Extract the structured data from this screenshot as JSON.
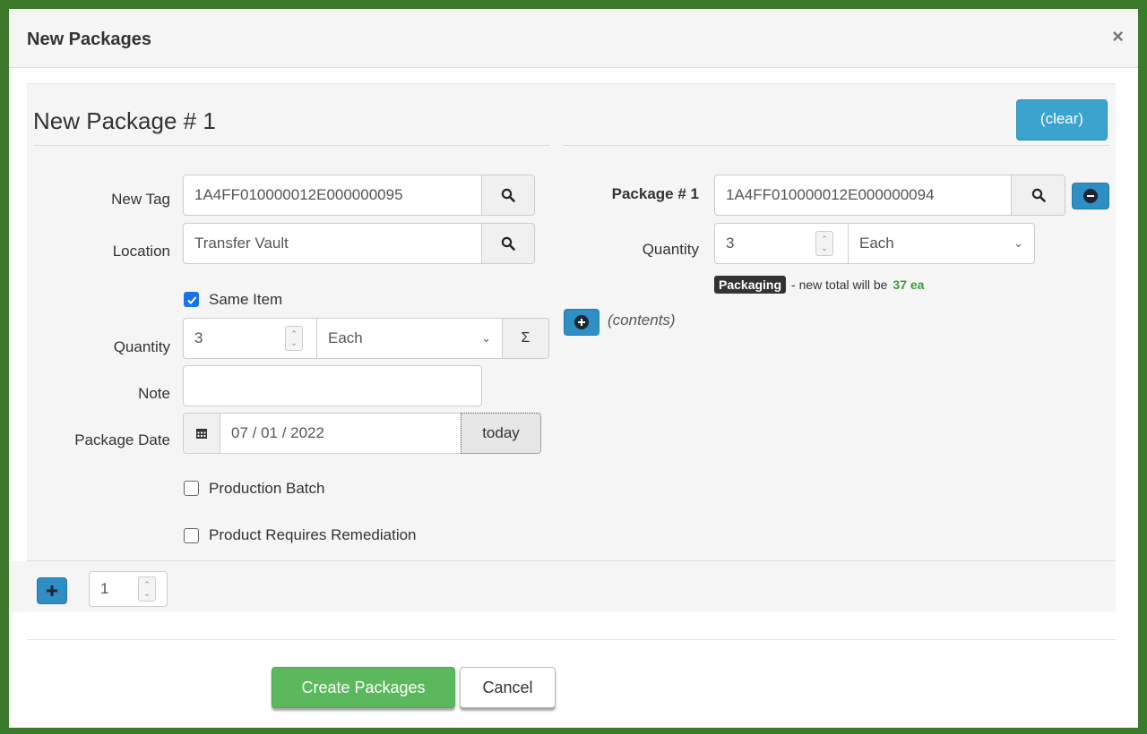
{
  "modal": {
    "title": "New Packages",
    "close": "×"
  },
  "package": {
    "heading": "New Package # 1",
    "clear_label": "(clear)",
    "new_tag_label": "New Tag",
    "new_tag_value": "1A4FF010000012E000000095",
    "location_label": "Location",
    "location_value": "Transfer Vault",
    "same_item_label": "Same Item",
    "quantity_label": "Quantity",
    "quantity_value": "3",
    "unit_value": "Each",
    "sum_symbol": "Σ",
    "note_label": "Note",
    "note_value": "",
    "date_label": "Package Date",
    "date_value": "07 / 01 / 2022",
    "today_label": "today",
    "production_batch_label": "Production Batch",
    "remediation_label": "Product Requires Remediation"
  },
  "source": {
    "label": "Package # 1",
    "tag_value": "1A4FF010000012E000000094",
    "quantity_label": "Quantity",
    "quantity_value": "3",
    "unit_value": "Each",
    "badge": "Packaging",
    "total_text": "- new total will be",
    "total_value": "37 ea",
    "contents_label": "(contents)"
  },
  "footer": {
    "count_value": "1",
    "create_label": "Create Packages",
    "cancel_label": "Cancel"
  },
  "colors": {
    "frame": "#3a7a2a",
    "accent": "#3aa4cf",
    "primary": "#5cb85c",
    "total": "#3c9a3c"
  }
}
